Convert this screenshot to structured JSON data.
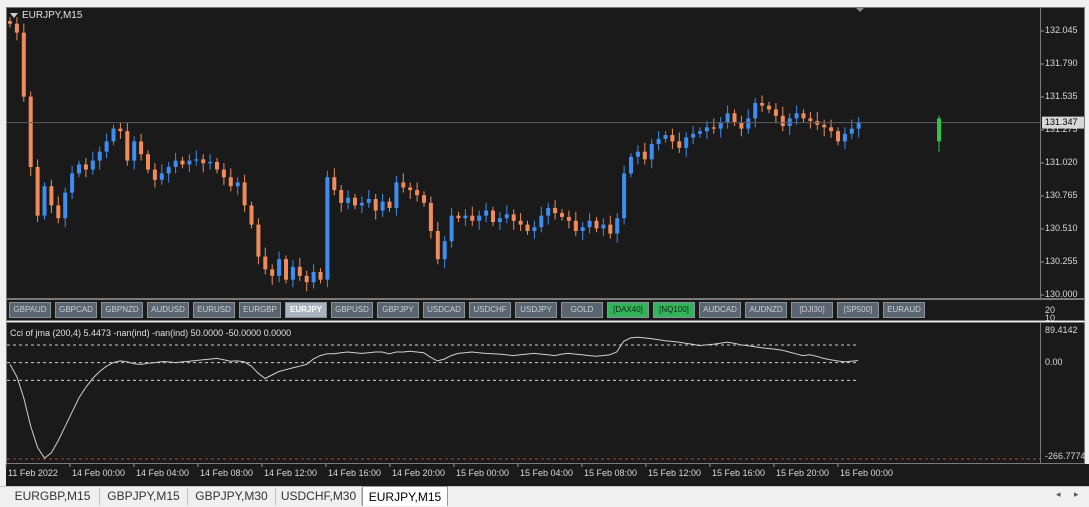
{
  "window": {
    "title": "EURJPY,M15"
  },
  "price_axis": {
    "labels": [
      "132.045",
      "131.790",
      "131.535",
      "131.275",
      "131.020",
      "130.765",
      "130.510",
      "130.255",
      "130.000"
    ],
    "current": "131.347"
  },
  "symbols": [
    {
      "label": "GBPAUD",
      "state": "normal"
    },
    {
      "label": "GBPCAD",
      "state": "normal"
    },
    {
      "label": "GBPNZD",
      "state": "normal"
    },
    {
      "label": "AUDUSD",
      "state": "normal"
    },
    {
      "label": "EURUSD",
      "state": "normal"
    },
    {
      "label": "EURGBP",
      "state": "normal"
    },
    {
      "label": "EURJPY",
      "state": "active"
    },
    {
      "label": "GBPUSD",
      "state": "normal"
    },
    {
      "label": "GBPJPY",
      "state": "normal"
    },
    {
      "label": "USDCAD",
      "state": "normal"
    },
    {
      "label": "USDCHF",
      "state": "normal"
    },
    {
      "label": "USDJPY",
      "state": "normal"
    },
    {
      "label": "GOLD",
      "state": "normal"
    },
    {
      "label": "[DAX40]",
      "state": "green"
    },
    {
      "label": "[NQ100]",
      "state": "green"
    },
    {
      "label": "AUDCAD",
      "state": "normal"
    },
    {
      "label": "AUDNZD",
      "state": "normal"
    },
    {
      "label": "[DJI30]",
      "state": "normal"
    },
    {
      "label": "[SP500]",
      "state": "normal"
    },
    {
      "label": "EURAUD",
      "state": "normal"
    }
  ],
  "indicator": {
    "title": "Cci of jma (200,4) 5.4473 -nan(ind) -nan(ind) 50.0000 -50.0000 0.0000",
    "axis_labels": {
      "top": "89.4142",
      "zero": "0.00",
      "bottom": "-266.7774"
    },
    "levels": [
      50,
      0,
      -50
    ]
  },
  "time_axis": [
    "11 Feb 2022",
    "14 Feb 00:00",
    "14 Feb 04:00",
    "14 Feb 08:00",
    "14 Feb 12:00",
    "14 Feb 16:00",
    "14 Feb 20:00",
    "15 Feb 00:00",
    "15 Feb 04:00",
    "15 Feb 08:00",
    "15 Feb 12:00",
    "15 Feb 16:00",
    "15 Feb 20:00",
    "16 Feb 00:00"
  ],
  "sub_axis": {
    "a": "20",
    "b": "10"
  },
  "tabs": [
    {
      "label": "EURGBP,M15",
      "active": false
    },
    {
      "label": "GBPJPY,M15",
      "active": false
    },
    {
      "label": "GBPJPY,M30",
      "active": false
    },
    {
      "label": "USDCHF,M30",
      "active": false
    },
    {
      "label": "EURJPY,M15",
      "active": true
    }
  ],
  "colors": {
    "bull": "#3d8ef0",
    "bear": "#f08c5a",
    "background": "#1a1a1a",
    "grid": "#7a7a7a",
    "green": "#33c24a"
  },
  "chart_data": {
    "type": "candlestick",
    "title": "EURJPY,M15",
    "ylim": [
      130.0,
      132.18
    ],
    "closes": [
      132.12,
      132.05,
      131.55,
      131.0,
      130.62,
      130.85,
      130.7,
      130.6,
      130.8,
      130.95,
      131.02,
      130.98,
      131.05,
      131.12,
      131.2,
      131.3,
      131.28,
      131.05,
      131.2,
      131.1,
      130.98,
      130.9,
      130.95,
      131.0,
      131.05,
      131.02,
      131.05,
      131.06,
      131.03,
      131.04,
      130.98,
      130.92,
      130.85,
      130.88,
      130.7,
      130.55,
      130.3,
      130.2,
      130.15,
      130.28,
      130.12,
      130.22,
      130.15,
      130.1,
      130.18,
      130.12,
      130.92,
      130.82,
      130.72,
      130.76,
      130.7,
      130.72,
      130.75,
      130.66,
      130.73,
      130.68,
      130.88,
      130.84,
      130.82,
      130.78,
      130.72,
      130.5,
      130.28,
      130.42,
      130.62,
      130.6,
      130.62,
      130.58,
      130.62,
      130.66,
      130.57,
      130.6,
      130.63,
      130.58,
      130.55,
      130.5,
      130.53,
      130.62,
      130.68,
      130.64,
      130.61,
      130.58,
      130.5,
      130.53,
      130.58,
      130.52,
      130.55,
      130.48,
      130.6,
      130.95,
      131.08,
      131.12,
      131.06,
      131.18,
      131.22,
      131.25,
      131.2,
      131.15,
      131.23,
      131.26,
      131.28,
      131.31,
      131.3,
      131.35,
      131.42,
      131.35,
      131.3,
      131.38,
      131.5,
      131.48,
      131.45,
      131.4,
      131.32,
      131.38,
      131.42,
      131.38,
      131.36,
      131.33,
      131.31,
      131.28,
      131.2,
      131.26,
      131.3,
      131.35
    ]
  }
}
